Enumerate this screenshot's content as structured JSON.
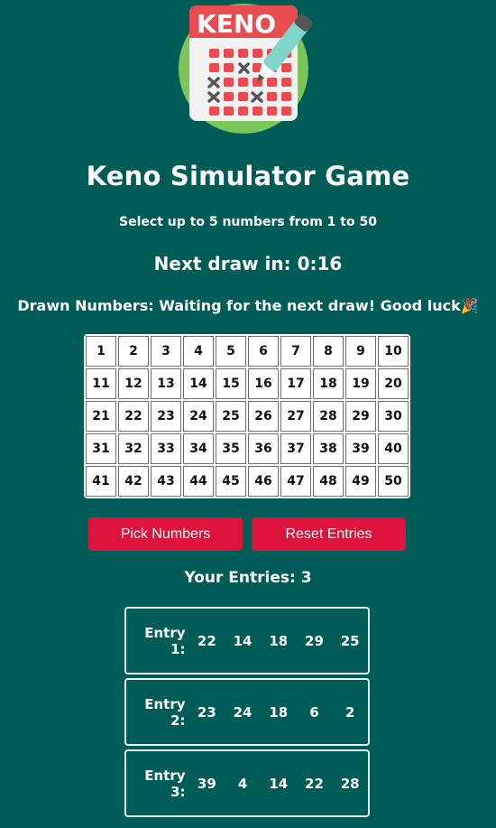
{
  "logo": {
    "text": "KENO",
    "name": "keno-ticket-logo"
  },
  "title": "Keno Simulator Game",
  "subtitle": "Select up to 5 numbers from 1 to 50",
  "next_draw": "Next draw in: 0:16",
  "drawn_numbers": "Drawn Numbers: Waiting for the next draw! Good luck🎉",
  "grid_numbers": [
    "1",
    "2",
    "3",
    "4",
    "5",
    "6",
    "7",
    "8",
    "9",
    "10",
    "11",
    "12",
    "13",
    "14",
    "15",
    "16",
    "17",
    "18",
    "19",
    "20",
    "21",
    "22",
    "23",
    "24",
    "25",
    "26",
    "27",
    "28",
    "29",
    "30",
    "31",
    "32",
    "33",
    "34",
    "35",
    "36",
    "37",
    "38",
    "39",
    "40",
    "41",
    "42",
    "43",
    "44",
    "45",
    "46",
    "47",
    "48",
    "49",
    "50"
  ],
  "buttons": {
    "pick": "Pick Numbers",
    "reset": "Reset Entries"
  },
  "entries_title": "Your Entries: 3",
  "entries": [
    {
      "label": "Entry 1:",
      "numbers": [
        "22",
        "14",
        "18",
        "29",
        "25"
      ]
    },
    {
      "label": "Entry 2:",
      "numbers": [
        "23",
        "24",
        "18",
        "6",
        "2"
      ]
    },
    {
      "label": "Entry 3:",
      "numbers": [
        "39",
        "4",
        "14",
        "22",
        "28"
      ]
    }
  ],
  "colors": {
    "background": "#005c57",
    "button": "#dc143c",
    "logo_circle": "#7bc55a",
    "logo_ticket": "#e84c4f"
  }
}
